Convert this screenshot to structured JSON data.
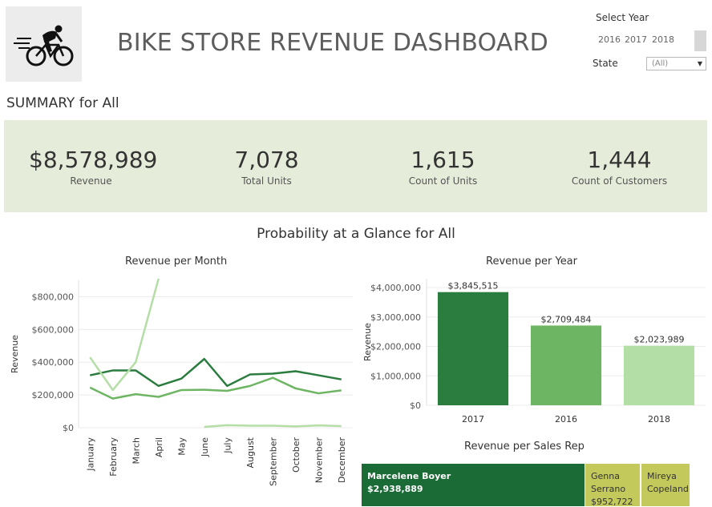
{
  "header": {
    "title": "BIKE STORE REVENUE DASHBOARD",
    "logo_icon": "cyclist-icon"
  },
  "filters": {
    "year_label": "Select Year",
    "years": [
      "2016",
      "2017",
      "2018"
    ],
    "state_label": "State",
    "state_value": "(All)"
  },
  "summary": {
    "title": "SUMMARY for All",
    "kpis": [
      {
        "value": "$8,578,989",
        "label": "Revenue"
      },
      {
        "value": "7,078",
        "label": "Total Units"
      },
      {
        "value": "1,615",
        "label": "Count of Units"
      },
      {
        "value": "1,444",
        "label": "Count of Customers"
      }
    ],
    "band_color": "#e6ecda"
  },
  "section_title": "Probability at a Glance for All",
  "chart_data": [
    {
      "type": "line",
      "title": "Revenue per Month",
      "ylabel": "Revenue",
      "xlabel": "",
      "categories": [
        "January",
        "February",
        "March",
        "April",
        "May",
        "June",
        "July",
        "August",
        "September",
        "October",
        "November",
        "December"
      ],
      "ylim": [
        0,
        900000
      ],
      "yticks": [
        0,
        200000,
        400000,
        600000,
        800000
      ],
      "ytick_labels": [
        "$0",
        "$200,000",
        "$400,000",
        "$600,000",
        "$800,000"
      ],
      "grid": true,
      "series": [
        {
          "color": "#2b7d3f",
          "values": [
            320000,
            350000,
            350000,
            255000,
            300000,
            420000,
            255000,
            325000,
            330000,
            345000,
            320000,
            295000
          ]
        },
        {
          "color": "#6db562",
          "values": [
            245000,
            178000,
            205000,
            188000,
            230000,
            232000,
            225000,
            255000,
            305000,
            240000,
            210000,
            228000
          ]
        },
        {
          "color": "#b3dea5",
          "values": [
            430000,
            230000,
            400000,
            910000,
            null,
            null,
            null,
            null,
            null,
            null,
            null,
            null
          ]
        },
        {
          "color": "#b3dea5",
          "values": [
            null,
            null,
            null,
            null,
            null,
            5000,
            15000,
            12000,
            12000,
            8000,
            14000,
            10000
          ]
        }
      ]
    },
    {
      "type": "bar",
      "title": "Revenue per Year",
      "ylabel": "Revenue",
      "xlabel": "",
      "categories": [
        "2017",
        "2016",
        "2018"
      ],
      "values": [
        3845515,
        2709484,
        2023989
      ],
      "value_labels": [
        "$3,845,515",
        "$2,709,484",
        "$2,023,989"
      ],
      "colors": [
        "#2b7d3f",
        "#6db562",
        "#b3dea5"
      ],
      "ylim": [
        0,
        4300000
      ],
      "yticks": [
        0,
        1000000,
        2000000,
        3000000,
        4000000
      ],
      "ytick_labels": [
        "$0",
        "$1,000,000",
        "$2,000,000",
        "$3,000,000",
        "$4,000,000"
      ],
      "grid": true
    }
  ],
  "sales_rep": {
    "title": "Revenue per Sales Rep",
    "cells": [
      {
        "name": "Marcelene Boyer",
        "value": "$2,938,889",
        "color": "#1a6b35",
        "text_color": "#ffffff"
      },
      {
        "name": "Genna Serrano",
        "value": "$952,722",
        "color": "#c3c95a",
        "text_color": "#333333"
      },
      {
        "name": "Mireya Copeland",
        "value": "",
        "color": "#c3c95a",
        "text_color": "#333333"
      }
    ]
  }
}
